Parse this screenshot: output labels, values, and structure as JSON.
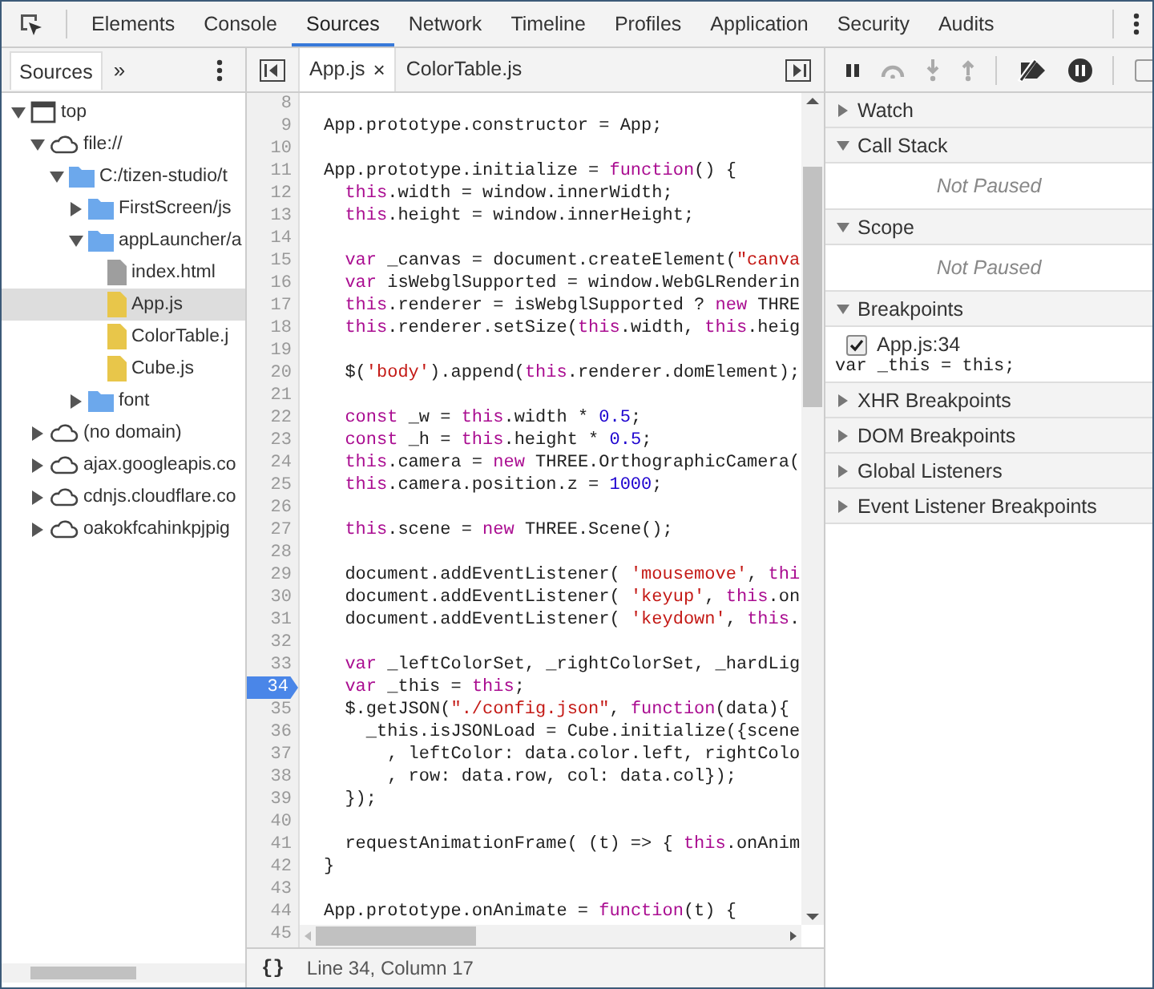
{
  "main_tabs": [
    {
      "label": "Elements",
      "selected": false
    },
    {
      "label": "Console",
      "selected": false
    },
    {
      "label": "Sources",
      "selected": true
    },
    {
      "label": "Network",
      "selected": false
    },
    {
      "label": "Timeline",
      "selected": false
    },
    {
      "label": "Profiles",
      "selected": false
    },
    {
      "label": "Application",
      "selected": false
    },
    {
      "label": "Security",
      "selected": false
    },
    {
      "label": "Audits",
      "selected": false
    }
  ],
  "navigator": {
    "tab": "Sources",
    "more": "»",
    "tree": [
      {
        "label": "top",
        "kind": "frame",
        "expanded": true,
        "children": [
          {
            "label": "file://",
            "kind": "cloud",
            "expanded": true,
            "children": [
              {
                "label": "C:/tizen-studio/t",
                "kind": "folder",
                "expanded": true,
                "children": [
                  {
                    "label": "FirstScreen/js",
                    "kind": "folder",
                    "expanded": false
                  },
                  {
                    "label": "appLauncher/a",
                    "kind": "folder",
                    "expanded": true,
                    "children": [
                      {
                        "label": "index.html",
                        "kind": "file-gray",
                        "selected": false
                      },
                      {
                        "label": "App.js",
                        "kind": "file-yellow",
                        "selected": true
                      },
                      {
                        "label": "ColorTable.j",
                        "kind": "file-yellow",
                        "selected": false
                      },
                      {
                        "label": "Cube.js",
                        "kind": "file-yellow",
                        "selected": false
                      }
                    ]
                  },
                  {
                    "label": "font",
                    "kind": "folder",
                    "expanded": false
                  }
                ]
              }
            ]
          },
          {
            "label": "(no domain)",
            "kind": "cloud",
            "expanded": false
          },
          {
            "label": "ajax.googleapis.co",
            "kind": "cloud",
            "expanded": false
          },
          {
            "label": "cdnjs.cloudflare.co",
            "kind": "cloud",
            "expanded": false
          },
          {
            "label": "oakokfcahinkpjpig",
            "kind": "cloud",
            "expanded": false
          }
        ]
      }
    ]
  },
  "editor_tabs": [
    {
      "label": "App.js",
      "close": "×",
      "selected": true
    },
    {
      "label": "ColorTable.js",
      "selected": false
    }
  ],
  "code_lines": [
    {
      "number": "8",
      "breakpoint": false
    },
    {
      "number": "9",
      "breakpoint": false,
      "tokens": [
        {
          "text": "App.prototype.constructor = App;",
          "kind": "plain"
        }
      ]
    },
    {
      "number": "10",
      "breakpoint": false
    },
    {
      "number": "11",
      "breakpoint": false,
      "tokens": [
        {
          "text": "App.prototype.initialize = ",
          "kind": "plain"
        },
        {
          "text": "function",
          "kind": "kw"
        },
        {
          "text": "() {",
          "kind": "plain"
        }
      ]
    },
    {
      "number": "12",
      "breakpoint": false,
      "tokens": [
        {
          "text": "  this",
          "kind": "kw"
        },
        {
          "text": ".width = window.innerWidth;",
          "kind": "plain"
        }
      ]
    },
    {
      "number": "13",
      "breakpoint": false,
      "tokens": [
        {
          "text": "  this",
          "kind": "kw"
        },
        {
          "text": ".height = window.innerHeight;",
          "kind": "plain"
        }
      ]
    },
    {
      "number": "14",
      "breakpoint": false
    },
    {
      "number": "15",
      "breakpoint": false,
      "tokens": [
        {
          "text": "  var",
          "kind": "kw"
        },
        {
          "text": " _canvas = document.createElement(",
          "kind": "plain"
        },
        {
          "text": "\"canva",
          "kind": "str"
        }
      ]
    },
    {
      "number": "16",
      "breakpoint": false,
      "tokens": [
        {
          "text": "  var",
          "kind": "kw"
        },
        {
          "text": " isWebglSupported = window.WebGLRenderin",
          "kind": "plain"
        }
      ]
    },
    {
      "number": "17",
      "breakpoint": false,
      "tokens": [
        {
          "text": "  this",
          "kind": "kw"
        },
        {
          "text": ".renderer = isWebglSupported ? ",
          "kind": "plain"
        },
        {
          "text": "new",
          "kind": "kw"
        },
        {
          "text": " THRE",
          "kind": "plain"
        }
      ]
    },
    {
      "number": "18",
      "breakpoint": false,
      "tokens": [
        {
          "text": "  this",
          "kind": "kw"
        },
        {
          "text": ".renderer.setSize(",
          "kind": "plain"
        },
        {
          "text": "this",
          "kind": "kw"
        },
        {
          "text": ".width, ",
          "kind": "plain"
        },
        {
          "text": "this",
          "kind": "kw"
        },
        {
          "text": ".heig",
          "kind": "plain"
        }
      ]
    },
    {
      "number": "19",
      "breakpoint": false
    },
    {
      "number": "20",
      "breakpoint": false,
      "tokens": [
        {
          "text": "  $(",
          "kind": "plain"
        },
        {
          "text": "'body'",
          "kind": "str"
        },
        {
          "text": ").append(",
          "kind": "plain"
        },
        {
          "text": "this",
          "kind": "kw"
        },
        {
          "text": ".renderer.domElement);",
          "kind": "plain"
        }
      ]
    },
    {
      "number": "21",
      "breakpoint": false
    },
    {
      "number": "22",
      "breakpoint": false,
      "tokens": [
        {
          "text": "  const",
          "kind": "kw"
        },
        {
          "text": " _w = ",
          "kind": "plain"
        },
        {
          "text": "this",
          "kind": "kw"
        },
        {
          "text": ".width * ",
          "kind": "plain"
        },
        {
          "text": "0.5",
          "kind": "num"
        },
        {
          "text": ";",
          "kind": "plain"
        }
      ]
    },
    {
      "number": "23",
      "breakpoint": false,
      "tokens": [
        {
          "text": "  const",
          "kind": "kw"
        },
        {
          "text": " _h = ",
          "kind": "plain"
        },
        {
          "text": "this",
          "kind": "kw"
        },
        {
          "text": ".height * ",
          "kind": "plain"
        },
        {
          "text": "0.5",
          "kind": "num"
        },
        {
          "text": ";",
          "kind": "plain"
        }
      ]
    },
    {
      "number": "24",
      "breakpoint": false,
      "tokens": [
        {
          "text": "  this",
          "kind": "kw"
        },
        {
          "text": ".camera = ",
          "kind": "plain"
        },
        {
          "text": "new",
          "kind": "kw"
        },
        {
          "text": " THREE.OrthographicCamera(",
          "kind": "plain"
        }
      ]
    },
    {
      "number": "25",
      "breakpoint": false,
      "tokens": [
        {
          "text": "  this",
          "kind": "kw"
        },
        {
          "text": ".camera.position.z = ",
          "kind": "plain"
        },
        {
          "text": "1000",
          "kind": "num"
        },
        {
          "text": ";",
          "kind": "plain"
        }
      ]
    },
    {
      "number": "26",
      "breakpoint": false
    },
    {
      "number": "27",
      "breakpoint": false,
      "tokens": [
        {
          "text": "  this",
          "kind": "kw"
        },
        {
          "text": ".scene = ",
          "kind": "plain"
        },
        {
          "text": "new",
          "kind": "kw"
        },
        {
          "text": " THREE.Scene();",
          "kind": "plain"
        }
      ]
    },
    {
      "number": "28",
      "breakpoint": false
    },
    {
      "number": "29",
      "breakpoint": false,
      "tokens": [
        {
          "text": "  document.addEventListener( ",
          "kind": "plain"
        },
        {
          "text": "'mousemove'",
          "kind": "str"
        },
        {
          "text": ", ",
          "kind": "plain"
        },
        {
          "text": "thi",
          "kind": "kw"
        }
      ]
    },
    {
      "number": "30",
      "breakpoint": false,
      "tokens": [
        {
          "text": "  document.addEventListener( ",
          "kind": "plain"
        },
        {
          "text": "'keyup'",
          "kind": "str"
        },
        {
          "text": ", ",
          "kind": "plain"
        },
        {
          "text": "this",
          "kind": "kw"
        },
        {
          "text": ".on",
          "kind": "plain"
        }
      ]
    },
    {
      "number": "31",
      "breakpoint": false,
      "tokens": [
        {
          "text": "  document.addEventListener( ",
          "kind": "plain"
        },
        {
          "text": "'keydown'",
          "kind": "str"
        },
        {
          "text": ", ",
          "kind": "plain"
        },
        {
          "text": "this",
          "kind": "kw"
        },
        {
          "text": ".",
          "kind": "plain"
        }
      ]
    },
    {
      "number": "32",
      "breakpoint": false
    },
    {
      "number": "33",
      "breakpoint": false,
      "tokens": [
        {
          "text": "  var",
          "kind": "kw"
        },
        {
          "text": " _leftColorSet, _rightColorSet, _hardLig",
          "kind": "plain"
        }
      ]
    },
    {
      "number": "34",
      "breakpoint": true,
      "tokens": [
        {
          "text": "  var",
          "kind": "kw"
        },
        {
          "text": " _this = ",
          "kind": "plain"
        },
        {
          "text": "this",
          "kind": "kw"
        },
        {
          "text": ";",
          "kind": "plain"
        }
      ]
    },
    {
      "number": "35",
      "breakpoint": false,
      "tokens": [
        {
          "text": "  $.getJSON(",
          "kind": "plain"
        },
        {
          "text": "\"./config.json\"",
          "kind": "str"
        },
        {
          "text": ", ",
          "kind": "plain"
        },
        {
          "text": "function",
          "kind": "kw"
        },
        {
          "text": "(data){",
          "kind": "plain"
        }
      ]
    },
    {
      "number": "36",
      "breakpoint": false,
      "tokens": [
        {
          "text": "    _this.isJSONLoad = Cube.initialize({scene",
          "kind": "plain"
        }
      ]
    },
    {
      "number": "37",
      "breakpoint": false,
      "tokens": [
        {
          "text": "      , leftColor: data.color.left, rightColo",
          "kind": "plain"
        }
      ]
    },
    {
      "number": "38",
      "breakpoint": false,
      "tokens": [
        {
          "text": "      , row: data.row, col: data.col});",
          "kind": "plain"
        }
      ]
    },
    {
      "number": "39",
      "breakpoint": false,
      "tokens": [
        {
          "text": "  });",
          "kind": "plain"
        }
      ]
    },
    {
      "number": "40",
      "breakpoint": false
    },
    {
      "number": "41",
      "breakpoint": false,
      "tokens": [
        {
          "text": "  requestAnimationFrame( (t) => { ",
          "kind": "plain"
        },
        {
          "text": "this",
          "kind": "kw"
        },
        {
          "text": ".onAnim",
          "kind": "plain"
        }
      ]
    },
    {
      "number": "42",
      "breakpoint": false,
      "tokens": [
        {
          "text": "}",
          "kind": "plain"
        }
      ]
    },
    {
      "number": "43",
      "breakpoint": false
    },
    {
      "number": "44",
      "breakpoint": false,
      "tokens": [
        {
          "text": "App.prototype.onAnimate = ",
          "kind": "plain"
        },
        {
          "text": "function",
          "kind": "kw"
        },
        {
          "text": "(t) {",
          "kind": "plain"
        }
      ]
    },
    {
      "number": "45",
      "breakpoint": false
    }
  ],
  "status_bar": {
    "format_button": "{}",
    "position": "Line 34, Column 17"
  },
  "debugger_toolbar": {
    "checkbox_checked": false
  },
  "debugger_sections": [
    {
      "title": "Watch",
      "expanded": false
    },
    {
      "title": "Call Stack",
      "expanded": true,
      "message": "Not Paused"
    },
    {
      "title": "Scope",
      "expanded": true,
      "message": "Not Paused"
    },
    {
      "title": "Breakpoints",
      "expanded": true,
      "breakpoints": [
        {
          "label": "App.js:34",
          "checked": true,
          "code": "var _this = this;"
        }
      ]
    },
    {
      "title": "XHR Breakpoints",
      "expanded": false
    },
    {
      "title": "DOM Breakpoints",
      "expanded": false
    },
    {
      "title": "Global Listeners",
      "expanded": false
    },
    {
      "title": "Event Listener Breakpoints",
      "expanded": false
    }
  ]
}
